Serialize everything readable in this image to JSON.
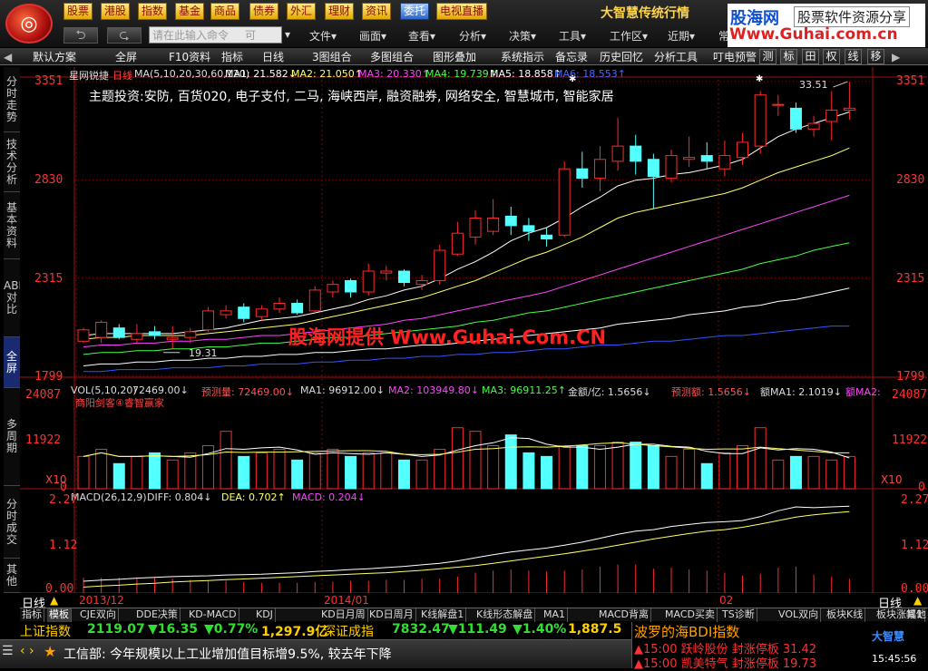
{
  "top_menu": [
    "股票",
    "港股",
    "指数",
    "基金",
    "商品",
    "债券",
    "外汇",
    "理财",
    "资讯",
    "委托",
    "电视直播"
  ],
  "command_placeholder": "请在此输入命令",
  "command_hint": "可",
  "nav_menus": [
    "文件▾",
    "画面▾",
    "查看▾",
    "分析▾",
    "决策▾",
    "工具▾",
    "工作区▾",
    "近期▾",
    "常"
  ],
  "brand": "大智慧传统行情",
  "site_watermark": {
    "name": "股海网",
    "tag": "股票软件资源分享",
    "url": "Www.Guhai.com.cn"
  },
  "toolbar": [
    "默认方案",
    "全屏",
    "F10资料",
    "指标",
    "日线",
    "3图组合",
    "多图组合",
    "图形叠加",
    "系统指示",
    "备忘录",
    "历史回忆",
    "分析工具",
    "叮电预警"
  ],
  "toolbar_keys": [
    "测",
    "标",
    "田",
    "权",
    "线",
    "移"
  ],
  "sidebar": [
    "分时走势",
    "技术分析",
    "基本资料",
    "ABH对比",
    "全屏",
    "多周期",
    "分时成交",
    "其他"
  ],
  "main": {
    "stock": "星网锐捷",
    "period": "日线",
    "ma_params": "MA(5,10,20,30,60,120)",
    "ma_values": [
      {
        "label": "MA1: 21.582↓",
        "color": "#ffffff"
      },
      {
        "label": "MA2: 21.050↑",
        "color": "#ffff66"
      },
      {
        "label": "MA3: 20.330↑",
        "color": "#ff44ff"
      },
      {
        "label": "MA4: 19.739↑",
        "color": "#44ff44"
      },
      {
        "label": "MA5: 18.858↑",
        "color": "#ffffff"
      },
      {
        "label": "MA6: 18.553↑",
        "color": "#4466ff"
      }
    ],
    "themes": "主题投资:安防, 百货020, 电子支付, 二马, 海峡西岸, 融资融券, 网络安全, 智慧城市, 智能家居",
    "high_label": "33.51",
    "low_label": "19.31",
    "yaxis": [
      "3351",
      "2830",
      "2315",
      "1799"
    ]
  },
  "vol": {
    "header": "VOL(5,10,20)",
    "v1": "72469.00↓",
    "forecast": "预测量: 72469.00↓",
    "ma1": "MA1: 96912.00↓",
    "ma2": "MA2: 103949.80↓",
    "ma3": "MA3: 96911.25↑",
    "amount": "金额/亿: 1.5656↓",
    "amount_fc": "预测额: 1.5656↓",
    "ama1": "额MA1: 2.1019↓",
    "ama2": "额MA2:",
    "sub": "商阳剑客④睿智赢家",
    "yaxis": [
      "24087",
      "11922",
      "0"
    ],
    "scale": "X10"
  },
  "macd": {
    "header": "MACD(26,12,9)",
    "diff": "DIFF: 0.804↓",
    "dea": "DEA: 0.702↑",
    "macd": "MACD: 0.204↓",
    "yaxis": [
      "2.27",
      "1.12",
      "0.00"
    ]
  },
  "xaxis": [
    "2013/12",
    "2014/01",
    "02"
  ],
  "period_label": "日线",
  "watermark_center": "股海网提供 Www.Guhai.Com.CN",
  "bottom_tabs": [
    "指标",
    "模板",
    "CJE双向",
    "DDE决策",
    "KD-MACD",
    "KDJ",
    "KD日月周",
    "KD日周月",
    "K线解盘1",
    "K线形态解盘",
    "MA1",
    "MACD背离",
    "MACD买卖",
    "TS诊断",
    "VOL双向",
    "板块K线",
    "板块涨幅1",
    "其他"
  ],
  "index_bar": {
    "sh_name": "上证指数",
    "sh_val": "2119.07",
    "sh_chg": "▼16.35",
    "sh_pct": "▼0.77%",
    "sh_amt": "1,297.9亿",
    "sz_name": "深证成指",
    "sz_val": "7832.47",
    "sz_chg": "▼111.49",
    "sz_pct": "▼1.40%",
    "sz_amt": "1,887.5亿"
  },
  "right_panel": {
    "title": "波罗的海BDI指数",
    "alert1": "▲15:00 跃岭股份 封涨停板 31.42",
    "alert2": "▲15:00 凯美特气 封涨停板 19.73",
    "logo": "大智慧",
    "time": "15:45:56"
  },
  "news": "工信部: 今年规模以上工业增加值目标增9.5%, 较去年下降",
  "candles": [
    {
      "o": 19.8,
      "c": 20.4,
      "h": 20.5,
      "l": 19.7
    },
    {
      "o": 20.0,
      "c": 20.8,
      "h": 20.9,
      "l": 19.7
    },
    {
      "o": 20.5,
      "c": 20.0,
      "h": 20.7,
      "l": 19.9
    },
    {
      "o": 19.9,
      "c": 20.2,
      "h": 20.7,
      "l": 19.7
    },
    {
      "o": 20.3,
      "c": 20.1,
      "h": 20.6,
      "l": 19.9
    },
    {
      "o": 19.9,
      "c": 20.0,
      "h": 20.6,
      "l": 19.4
    },
    {
      "o": 20.0,
      "c": 20.3,
      "h": 20.5,
      "l": 19.7
    },
    {
      "o": 20.4,
      "c": 21.4,
      "h": 21.6,
      "l": 20.3
    },
    {
      "o": 21.2,
      "c": 21.4,
      "h": 21.7,
      "l": 21.0
    },
    {
      "o": 21.6,
      "c": 21.0,
      "h": 21.8,
      "l": 20.8
    },
    {
      "o": 21.1,
      "c": 21.5,
      "h": 21.7,
      "l": 20.9
    },
    {
      "o": 21.5,
      "c": 21.8,
      "h": 22.1,
      "l": 21.3
    },
    {
      "o": 21.8,
      "c": 21.3,
      "h": 22.0,
      "l": 21.2
    },
    {
      "o": 21.4,
      "c": 22.5,
      "h": 22.7,
      "l": 21.3
    },
    {
      "o": 22.4,
      "c": 22.8,
      "h": 23.0,
      "l": 22.1
    },
    {
      "o": 23.0,
      "c": 22.4,
      "h": 23.1,
      "l": 22.1
    },
    {
      "o": 22.4,
      "c": 23.5,
      "h": 23.9,
      "l": 22.2
    },
    {
      "o": 23.4,
      "c": 23.5,
      "h": 23.8,
      "l": 23.0
    },
    {
      "o": 23.5,
      "c": 22.9,
      "h": 23.6,
      "l": 22.7
    },
    {
      "o": 22.8,
      "c": 23.0,
      "h": 23.3,
      "l": 22.5
    },
    {
      "o": 23.0,
      "c": 24.6,
      "h": 24.9,
      "l": 22.8
    },
    {
      "o": 24.4,
      "c": 25.5,
      "h": 26.1,
      "l": 24.3
    },
    {
      "o": 25.3,
      "c": 26.3,
      "h": 26.7,
      "l": 24.9
    },
    {
      "o": 25.6,
      "c": 26.3,
      "h": 27.3,
      "l": 25.4
    },
    {
      "o": 26.4,
      "c": 25.9,
      "h": 26.9,
      "l": 25.4
    },
    {
      "o": 25.9,
      "c": 25.6,
      "h": 26.3,
      "l": 25.1
    },
    {
      "o": 25.4,
      "c": 25.2,
      "h": 25.8,
      "l": 24.8
    },
    {
      "o": 25.4,
      "c": 28.9,
      "h": 29.3,
      "l": 25.3
    },
    {
      "o": 28.9,
      "c": 28.4,
      "h": 29.8,
      "l": 27.9
    },
    {
      "o": 28.4,
      "c": 29.4,
      "h": 30.1,
      "l": 27.7
    },
    {
      "o": 29.3,
      "c": 30.1,
      "h": 31.6,
      "l": 28.8
    },
    {
      "o": 30.1,
      "c": 29.3,
      "h": 30.7,
      "l": 28.6
    },
    {
      "o": 29.4,
      "c": 28.5,
      "h": 29.7,
      "l": 26.8
    },
    {
      "o": 28.4,
      "c": 29.6,
      "h": 29.9,
      "l": 28.2
    },
    {
      "o": 29.4,
      "c": 29.5,
      "h": 30.6,
      "l": 29.0
    },
    {
      "o": 29.6,
      "c": 29.3,
      "h": 30.3,
      "l": 28.9
    },
    {
      "o": 28.9,
      "c": 29.6,
      "h": 30.4,
      "l": 28.5
    },
    {
      "o": 29.5,
      "c": 30.3,
      "h": 30.8,
      "l": 29.1
    },
    {
      "o": 30.1,
      "c": 32.8,
      "h": 33.0,
      "l": 29.7
    },
    {
      "o": 32.3,
      "c": 32.3,
      "h": 32.8,
      "l": 31.7
    },
    {
      "o": 32.1,
      "c": 31.0,
      "h": 32.4,
      "l": 30.8
    },
    {
      "o": 31.0,
      "c": 31.3,
      "h": 31.7,
      "l": 30.6
    },
    {
      "o": 31.4,
      "c": 32.0,
      "h": 33.0,
      "l": 30.4
    },
    {
      "o": 32.0,
      "c": 32.1,
      "h": 33.5,
      "l": 31.5
    }
  ],
  "volumes": [
    9,
    11,
    7,
    9,
    10,
    8,
    10,
    12,
    16,
    9,
    10,
    11,
    8,
    10,
    11,
    9,
    10,
    10,
    8,
    8,
    11,
    17,
    16,
    12,
    15,
    10,
    9,
    12,
    12,
    12,
    13,
    13,
    12,
    9,
    11,
    7,
    10,
    12,
    17,
    8,
    9,
    9,
    8,
    9
  ],
  "ma_lines": {
    "ma1": [
      20.1,
      20.2,
      20.2,
      20.2,
      20.2,
      20.2,
      20.3,
      20.4,
      20.5,
      20.7,
      20.9,
      21.0,
      21.1,
      21.3,
      21.5,
      21.7,
      22.0,
      22.2,
      22.5,
      22.7,
      23.1,
      23.6,
      24.0,
      24.5,
      25.1,
      25.5,
      25.8,
      26.3,
      26.9,
      27.4,
      28.0,
      28.3,
      28.4,
      28.6,
      28.7,
      28.9,
      29.1,
      29.4,
      30.0,
      30.6,
      31.0,
      31.3,
      31.6,
      31.9
    ],
    "ma2": [
      19.9,
      20.0,
      20.0,
      20.1,
      20.1,
      20.1,
      20.1,
      20.2,
      20.3,
      20.4,
      20.5,
      20.6,
      20.7,
      20.9,
      21.1,
      21.3,
      21.5,
      21.7,
      21.9,
      22.1,
      22.4,
      22.7,
      23.0,
      23.4,
      23.8,
      24.2,
      24.5,
      24.9,
      25.3,
      25.8,
      26.3,
      26.6,
      26.8,
      27.0,
      27.2,
      27.4,
      27.6,
      27.9,
      28.3,
      28.7,
      29.0,
      29.3,
      29.6,
      30.0
    ],
    "ma3": [
      19.5,
      19.6,
      19.6,
      19.7,
      19.7,
      19.8,
      19.8,
      19.9,
      19.9,
      20.0,
      20.1,
      20.1,
      20.2,
      20.3,
      20.4,
      20.5,
      20.6,
      20.7,
      20.9,
      21.0,
      21.2,
      21.4,
      21.6,
      21.8,
      22.0,
      22.2,
      22.4,
      22.7,
      23.0,
      23.3,
      23.6,
      23.9,
      24.2,
      24.5,
      24.8,
      25.1,
      25.4,
      25.7,
      26.0,
      26.3,
      26.6,
      26.9,
      27.2,
      27.5
    ],
    "ma4": [
      19.1,
      19.2,
      19.2,
      19.3,
      19.3,
      19.4,
      19.4,
      19.5,
      19.5,
      19.6,
      19.7,
      19.7,
      19.8,
      19.9,
      20.0,
      20.0,
      20.1,
      20.2,
      20.3,
      20.4,
      20.5,
      20.6,
      20.8,
      20.9,
      21.1,
      21.3,
      21.4,
      21.6,
      21.8,
      22.0,
      22.2,
      22.4,
      22.6,
      22.8,
      23.0,
      23.2,
      23.4,
      23.6,
      23.9,
      24.1,
      24.3,
      24.6,
      24.8,
      25.0
    ],
    "ma5": [
      18.5,
      18.6,
      18.6,
      18.7,
      18.7,
      18.8,
      18.8,
      18.9,
      18.9,
      19.0,
      19.0,
      19.1,
      19.1,
      19.2,
      19.2,
      19.3,
      19.4,
      19.4,
      19.5,
      19.6,
      19.6,
      19.7,
      19.8,
      19.9,
      20.0,
      20.1,
      20.2,
      20.3,
      20.4,
      20.5,
      20.7,
      20.8,
      20.9,
      21.0,
      21.2,
      21.3,
      21.4,
      21.6,
      21.7,
      21.9,
      22.0,
      22.2,
      22.4,
      22.6
    ],
    "ma6": [
      18.2,
      18.2,
      18.3,
      18.3,
      18.3,
      18.4,
      18.4,
      18.4,
      18.5,
      18.5,
      18.6,
      18.6,
      18.6,
      18.7,
      18.7,
      18.8,
      18.8,
      18.9,
      18.9,
      19.0,
      19.0,
      19.1,
      19.1,
      19.2,
      19.2,
      19.3,
      19.4,
      19.4,
      19.5,
      19.6,
      19.6,
      19.7,
      19.8,
      19.8,
      19.9,
      20.0,
      20.1,
      20.1,
      20.2,
      20.3,
      20.4,
      20.5,
      20.6,
      20.6
    ]
  },
  "macd_series": {
    "diff": [
      0.3,
      0.33,
      0.35,
      0.38,
      0.4,
      0.42,
      0.43,
      0.44,
      0.46,
      0.47,
      0.48,
      0.5,
      0.52,
      0.55,
      0.57,
      0.6,
      0.62,
      0.65,
      0.68,
      0.72,
      0.76,
      0.82,
      0.9,
      0.98,
      1.05,
      1.1,
      1.15,
      1.22,
      1.3,
      1.4,
      1.5,
      1.58,
      1.62,
      1.7,
      1.75,
      1.8,
      1.82,
      1.85,
      1.95,
      2.1,
      2.2,
      2.18,
      2.2,
      2.22
    ],
    "dea": [
      0.15,
      0.18,
      0.2,
      0.23,
      0.25,
      0.28,
      0.3,
      0.32,
      0.34,
      0.36,
      0.38,
      0.4,
      0.42,
      0.44,
      0.46,
      0.48,
      0.5,
      0.52,
      0.55,
      0.58,
      0.62,
      0.66,
      0.7,
      0.76,
      0.82,
      0.88,
      0.94,
      1.0,
      1.07,
      1.14,
      1.22,
      1.3,
      1.38,
      1.45,
      1.52,
      1.58,
      1.62,
      1.68,
      1.76,
      1.85,
      1.94,
      2.0,
      2.04,
      2.08
    ]
  }
}
